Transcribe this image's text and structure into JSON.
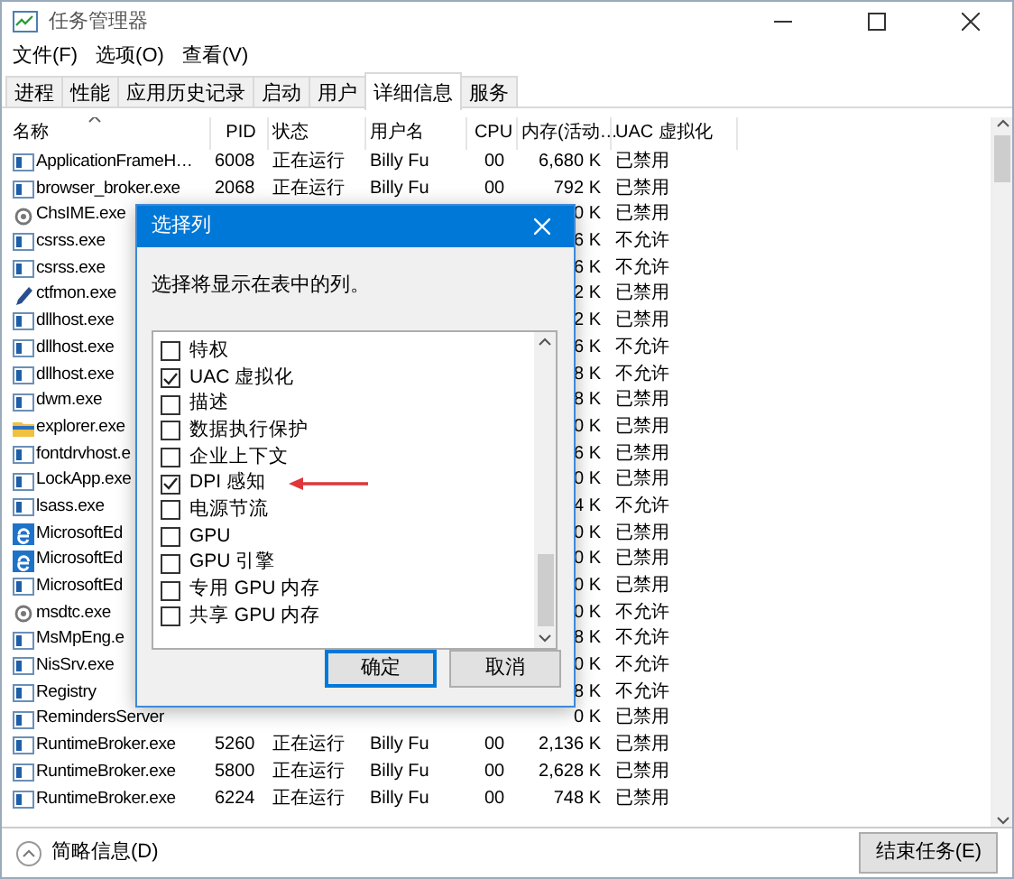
{
  "window": {
    "title": "任务管理器"
  },
  "menu": [
    "文件(F)",
    "选项(O)",
    "查看(V)"
  ],
  "tabs": [
    {
      "label": "进程",
      "selected": false
    },
    {
      "label": "性能",
      "selected": false
    },
    {
      "label": "应用历史记录",
      "selected": false
    },
    {
      "label": "启动",
      "selected": false
    },
    {
      "label": "用户",
      "selected": false
    },
    {
      "label": "详细信息",
      "selected": true
    },
    {
      "label": "服务",
      "selected": false
    }
  ],
  "table": {
    "columns": [
      "名称",
      "PID",
      "状态",
      "用户名",
      "CPU",
      "内存(活动…",
      "UAC 虚拟化"
    ],
    "rows": [
      {
        "kind": "app",
        "name": "ApplicationFrameH…",
        "pid": "6008",
        "status": "正在运行",
        "user": "Billy Fu",
        "cpu": "00",
        "memory": "6,680 K",
        "uac": "已禁用"
      },
      {
        "kind": "app",
        "name": "browser_broker.exe",
        "pid": "2068",
        "status": "正在运行",
        "user": "Billy Fu",
        "cpu": "00",
        "memory": "792 K",
        "uac": "已禁用"
      },
      {
        "kind": "service",
        "name": "ChsIME.exe",
        "memory": "0 K",
        "uac": "已禁用"
      },
      {
        "kind": "app",
        "name": "csrss.exe",
        "memory": "6 K",
        "uac": "不允许"
      },
      {
        "kind": "app",
        "name": "csrss.exe",
        "memory": "6 K",
        "uac": "不允许"
      },
      {
        "kind": "pen",
        "name": "ctfmon.exe",
        "memory": "2 K",
        "uac": "已禁用"
      },
      {
        "kind": "app",
        "name": "dllhost.exe",
        "memory": "2 K",
        "uac": "已禁用"
      },
      {
        "kind": "app",
        "name": "dllhost.exe",
        "memory": "6 K",
        "uac": "不允许"
      },
      {
        "kind": "app",
        "name": "dllhost.exe",
        "memory": "8 K",
        "uac": "不允许"
      },
      {
        "kind": "app",
        "name": "dwm.exe",
        "memory": "8 K",
        "uac": "已禁用"
      },
      {
        "kind": "folder",
        "name": "explorer.exe",
        "memory": "0 K",
        "uac": "已禁用"
      },
      {
        "kind": "app",
        "name": "fontdrvhost.e",
        "memory": "6 K",
        "uac": "已禁用"
      },
      {
        "kind": "app",
        "name": "LockApp.exe",
        "memory": "0 K",
        "uac": "已禁用"
      },
      {
        "kind": "app",
        "name": "lsass.exe",
        "memory": "4 K",
        "uac": "不允许"
      },
      {
        "kind": "edge",
        "name": "MicrosoftEd",
        "memory": "0 K",
        "uac": "已禁用"
      },
      {
        "kind": "edge",
        "name": "MicrosoftEd",
        "memory": "0 K",
        "uac": "已禁用"
      },
      {
        "kind": "app",
        "name": "MicrosoftEd",
        "memory": "0 K",
        "uac": "已禁用"
      },
      {
        "kind": "service",
        "name": "msdtc.exe",
        "memory": "0 K",
        "uac": "不允许"
      },
      {
        "kind": "app",
        "name": "MsMpEng.e",
        "memory": "8 K",
        "uac": "不允许"
      },
      {
        "kind": "app",
        "name": "NisSrv.exe",
        "memory": "0 K",
        "uac": "不允许"
      },
      {
        "kind": "app",
        "name": "Registry",
        "memory": "8 K",
        "uac": "不允许"
      },
      {
        "kind": "app",
        "name": "RemindersServer",
        "memory": "0 K",
        "uac": "已禁用"
      },
      {
        "kind": "app",
        "name": "RuntimeBroker.exe",
        "pid": "5260",
        "status": "正在运行",
        "user": "Billy Fu",
        "cpu": "00",
        "memory": "2,136 K",
        "uac": "已禁用"
      },
      {
        "kind": "app",
        "name": "RuntimeBroker.exe",
        "pid": "5800",
        "status": "正在运行",
        "user": "Billy Fu",
        "cpu": "00",
        "memory": "2,628 K",
        "uac": "已禁用"
      },
      {
        "kind": "app",
        "name": "RuntimeBroker.exe",
        "pid": "6224",
        "status": "正在运行",
        "user": "Billy Fu",
        "cpu": "00",
        "memory": "748 K",
        "uac": "已禁用"
      }
    ]
  },
  "dialog": {
    "title": "选择列",
    "prompt": "选择将显示在表中的列。",
    "options": [
      {
        "label": "特权",
        "checked": false,
        "annotated": false
      },
      {
        "label": "UAC 虚拟化",
        "checked": true,
        "annotated": false
      },
      {
        "label": "描述",
        "checked": false,
        "annotated": false
      },
      {
        "label": "数据执行保护",
        "checked": false,
        "annotated": false
      },
      {
        "label": "企业上下文",
        "checked": false,
        "annotated": false
      },
      {
        "label": "DPI 感知",
        "checked": true,
        "annotated": true
      },
      {
        "label": "电源节流",
        "checked": false,
        "annotated": false
      },
      {
        "label": "GPU",
        "checked": false,
        "annotated": false
      },
      {
        "label": "GPU 引擎",
        "checked": false,
        "annotated": false
      },
      {
        "label": "专用 GPU 内存",
        "checked": false,
        "annotated": false
      },
      {
        "label": "共享 GPU 内存",
        "checked": false,
        "annotated": false
      }
    ],
    "buttons": [
      {
        "label": "确定",
        "default": true
      },
      {
        "label": "取消",
        "default": false
      }
    ]
  },
  "footer": {
    "toggle": "简略信息(D)",
    "end_task": "结束任务(E)"
  }
}
